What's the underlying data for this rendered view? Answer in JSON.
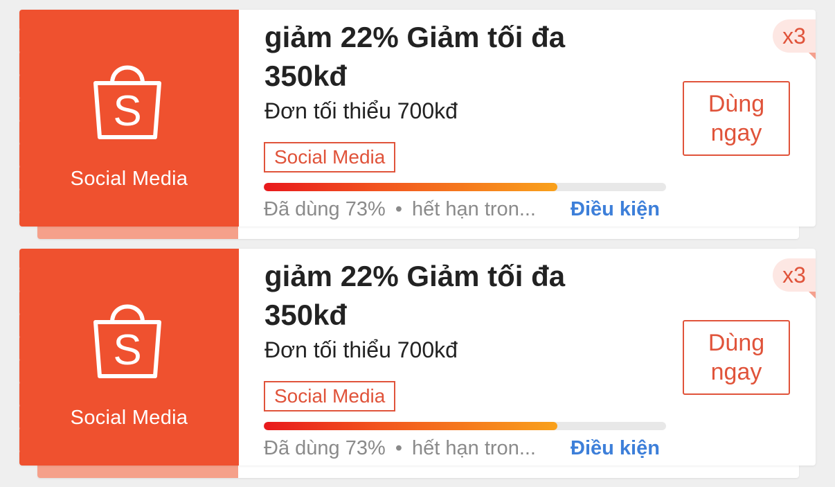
{
  "vouchers": [
    {
      "brand_label": "Social Media",
      "title": "giảm 22% Giảm tối đa 350kđ",
      "min_order": "Đơn tối thiểu 700kđ",
      "tag": "Social Media",
      "used_percent": 73,
      "used_text": "Đã dùng 73%",
      "separator": "•",
      "expiry_text": "hết hạn tron...",
      "conditions_link": "Điều kiện",
      "use_button": "Dùng ngay",
      "quantity": "x3"
    },
    {
      "brand_label": "Social Media",
      "title": "giảm 22% Giảm tối đa 350kđ",
      "min_order": "Đơn tối thiểu 700kđ",
      "tag": "Social Media",
      "used_percent": 73,
      "used_text": "Đã dùng 73%",
      "separator": "•",
      "expiry_text": "hết hạn tron...",
      "conditions_link": "Điều kiện",
      "use_button": "Dùng ngay",
      "quantity": "x3"
    }
  ],
  "colors": {
    "brand": "#ef512f",
    "accent_text": "#e0533a",
    "link": "#3d7fd9"
  },
  "icons": {
    "brand_icon": "shopping-bag-icon"
  }
}
